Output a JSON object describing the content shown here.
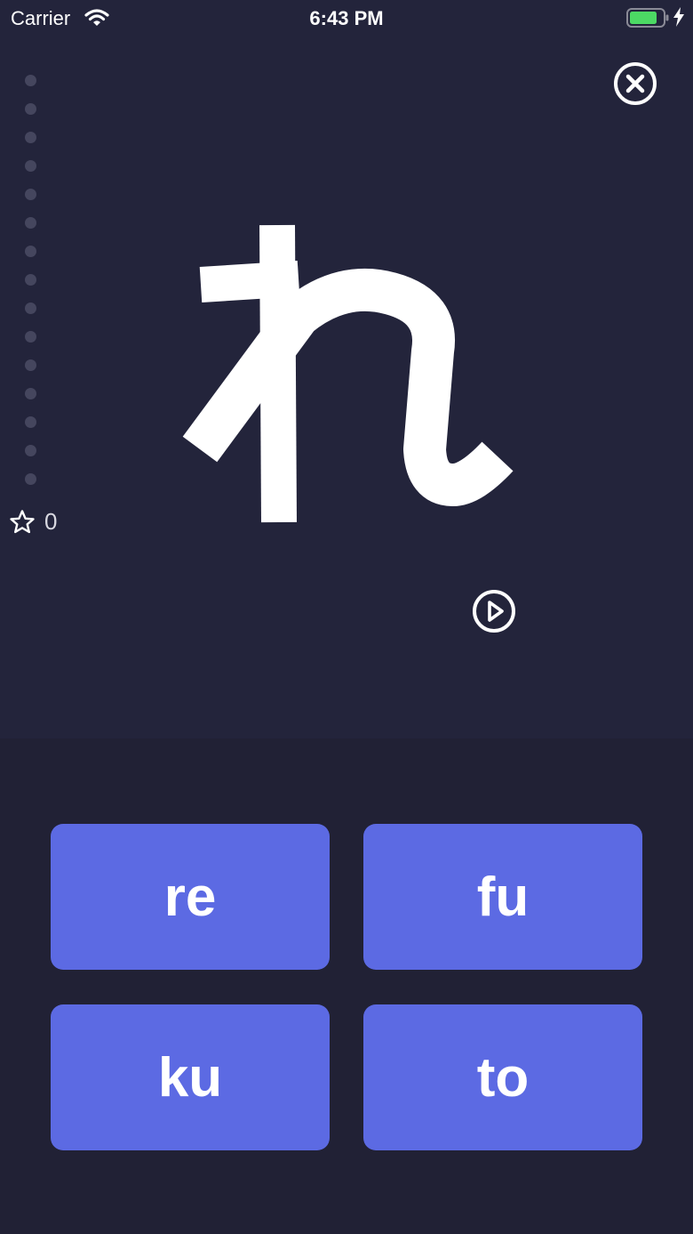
{
  "status_bar": {
    "carrier": "Carrier",
    "time": "6:43 PM",
    "icons": [
      "wifi-icon",
      "battery-icon",
      "charging-bolt-icon"
    ]
  },
  "header": {
    "close_icon": "close-circle-icon"
  },
  "progress": {
    "total_dots": 15
  },
  "score": {
    "icon": "star-outline-icon",
    "value": "0"
  },
  "card": {
    "character": "れ",
    "audio_icon": "play-circle-icon"
  },
  "choices": [
    {
      "label": "re"
    },
    {
      "label": "fu"
    },
    {
      "label": "ku"
    },
    {
      "label": "to"
    }
  ],
  "colors": {
    "background_top": "#23243b",
    "background_bottom": "#212135",
    "choice_button": "#5c6ae3",
    "progress_dot": "#45465e",
    "battery_fill": "#4cd964"
  }
}
